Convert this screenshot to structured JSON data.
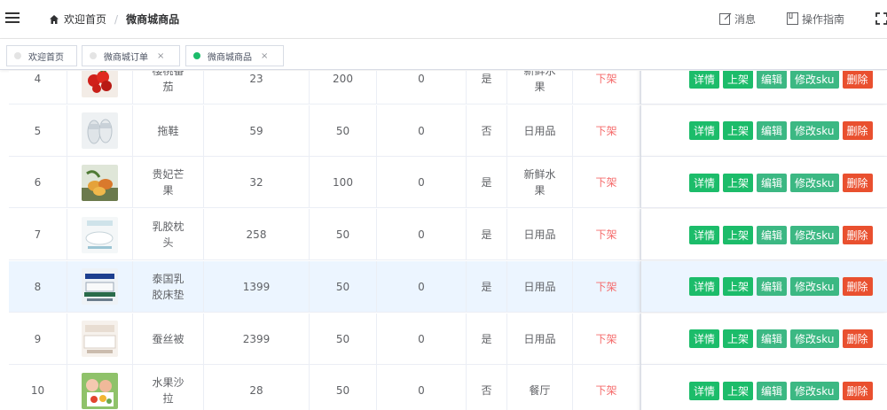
{
  "header": {
    "breadcrumb": {
      "home": "欢迎首页",
      "current": "微商城商品"
    },
    "message_label": "消息",
    "guide_label": "操作指南"
  },
  "tags": [
    {
      "label": "欢迎首页",
      "active": false,
      "closable": false
    },
    {
      "label": "微商城订单",
      "active": false,
      "closable": true
    },
    {
      "label": "微商城商品",
      "active": true,
      "closable": true
    }
  ],
  "close_glyph": "×",
  "colors": {
    "accent": "#1cbc6a",
    "danger": "#e9502f",
    "status_red": "#f56c6c",
    "highlight_row": "#ecf5ff"
  },
  "actions": {
    "detail": "详情",
    "shelf": "上架",
    "edit": "编辑",
    "sku": "修改sku",
    "delete": "删除"
  },
  "table": {
    "rows": [
      {
        "no": "4",
        "name": "樱桃番茄",
        "price": "23",
        "stock": "200",
        "sales": "0",
        "recommend": "是",
        "category": "新鲜水果",
        "status": "下架",
        "thumb": "tomato",
        "highlight": false
      },
      {
        "no": "5",
        "name": "拖鞋",
        "price": "59",
        "stock": "50",
        "sales": "0",
        "recommend": "否",
        "category": "日用品",
        "status": "下架",
        "thumb": "slippers",
        "highlight": false
      },
      {
        "no": "6",
        "name": "贵妃芒果",
        "price": "32",
        "stock": "100",
        "sales": "0",
        "recommend": "是",
        "category": "新鲜水果",
        "status": "下架",
        "thumb": "mango",
        "highlight": false
      },
      {
        "no": "7",
        "name": "乳胶枕头",
        "price": "258",
        "stock": "50",
        "sales": "0",
        "recommend": "是",
        "category": "日用品",
        "status": "下架",
        "thumb": "pillow",
        "highlight": false
      },
      {
        "no": "8",
        "name": "泰国乳胶床垫",
        "price": "1399",
        "stock": "50",
        "sales": "0",
        "recommend": "是",
        "category": "日用品",
        "status": "下架",
        "thumb": "mattress",
        "highlight": true
      },
      {
        "no": "9",
        "name": "蚕丝被",
        "price": "2399",
        "stock": "50",
        "sales": "0",
        "recommend": "是",
        "category": "日用品",
        "status": "下架",
        "thumb": "quilt",
        "highlight": false
      },
      {
        "no": "10",
        "name": "水果沙拉",
        "price": "28",
        "stock": "50",
        "sales": "0",
        "recommend": "否",
        "category": "餐厅",
        "status": "下架",
        "thumb": "salad",
        "highlight": false
      }
    ]
  }
}
